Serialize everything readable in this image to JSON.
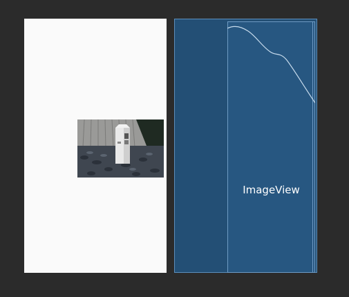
{
  "blueprint": {
    "view_label": "ImageView"
  },
  "colors": {
    "canvas_bg": "#2b2b2b",
    "design_surface": "#fafafa",
    "blueprint_bg": "#234f75",
    "blueprint_outline": "#6f9bc4"
  }
}
